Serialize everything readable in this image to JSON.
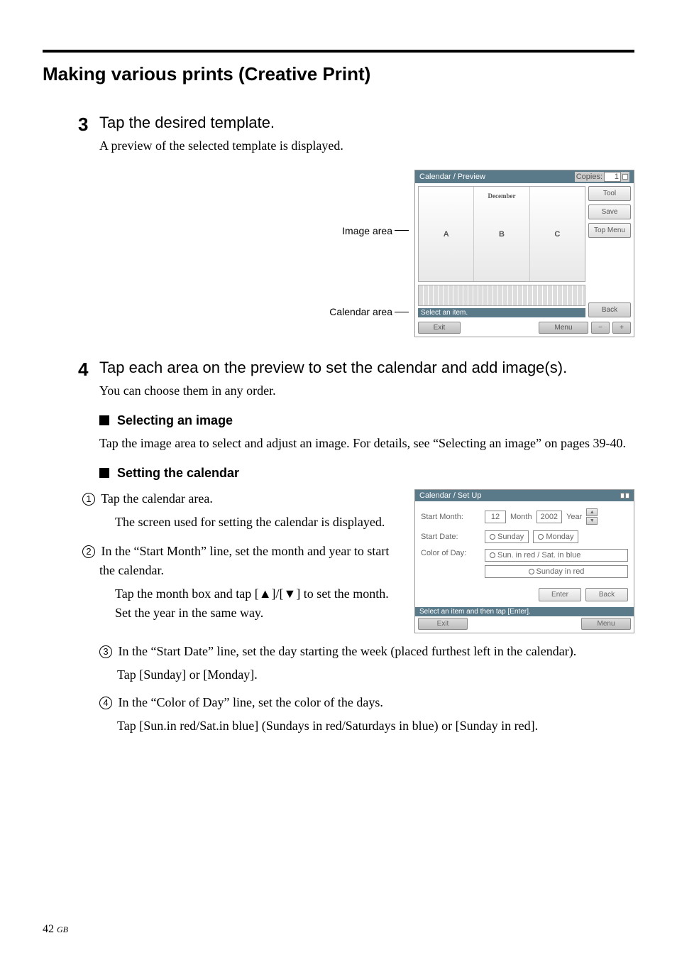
{
  "header": {
    "title": "Making various prints (Creative Print)"
  },
  "step3": {
    "num": "3",
    "heading": "Tap the desired template.",
    "text": "A preview of the selected template is displayed."
  },
  "previewCallouts": {
    "imageArea": "Image area",
    "calendarArea": "Calendar area"
  },
  "calPreview": {
    "titleBar": "Calendar / Preview",
    "copiesLabel": "Copies:",
    "copiesValue": "1",
    "month": "December",
    "slots": [
      "A",
      "B",
      "C"
    ],
    "status": "Select an item.",
    "buttons": {
      "tool": "Tool",
      "save": "Save",
      "topMenu": "Top Menu",
      "back": "Back"
    },
    "footer": {
      "exit": "Exit",
      "menu": "Menu",
      "minus": "−",
      "plus": "+"
    }
  },
  "step4": {
    "num": "4",
    "heading": "Tap each area on the preview to set the calendar and add image(s).",
    "text": "You can choose them in any order."
  },
  "selectImage": {
    "heading": "Selecting an image",
    "text": "Tap the image area to select and adjust an image.  For details, see “Selecting an image” on pages 39-40."
  },
  "setCal": {
    "heading": "Setting the calendar",
    "n1": "1",
    "n1a": "Tap the calendar area.",
    "n1b": "The screen used for setting the calendar is displayed.",
    "n2": "2",
    "n2a": "In the “Start Month” line, set the month and year to start the calendar.",
    "n2b": "Tap the month box and tap [▲]/[▼] to set the month. Set the year in the same way.",
    "n3": "3",
    "n3a": "In the “Start Date” line, set the day starting the week (placed furthest left in the calendar).",
    "n3b": "Tap [Sunday] or [Monday].",
    "n4": "4",
    "n4a": "In the “Color of Day” line, set the color of the days.",
    "n4b": "Tap [Sun.in red/Sat.in blue] (Sundays in red/Saturdays in blue) or [Sunday in red]."
  },
  "setupFig": {
    "titleBar": "Calendar / Set Up",
    "startMonth": "Start Month:",
    "monthVal": "12",
    "monthLabel": "Month",
    "yearVal": "2002",
    "yearLabel": "Year",
    "startDate": "Start Date:",
    "sunday": "Sunday",
    "monday": "Monday",
    "colorOfDay": "Color of Day:",
    "opt1": "Sun. in red / Sat. in blue",
    "opt2": "Sunday in red",
    "enter": "Enter",
    "back": "Back",
    "status": "Select an item and then tap [Enter].",
    "exit": "Exit",
    "menu": "Menu"
  },
  "pageNum": {
    "num": "42",
    "region": "GB"
  }
}
